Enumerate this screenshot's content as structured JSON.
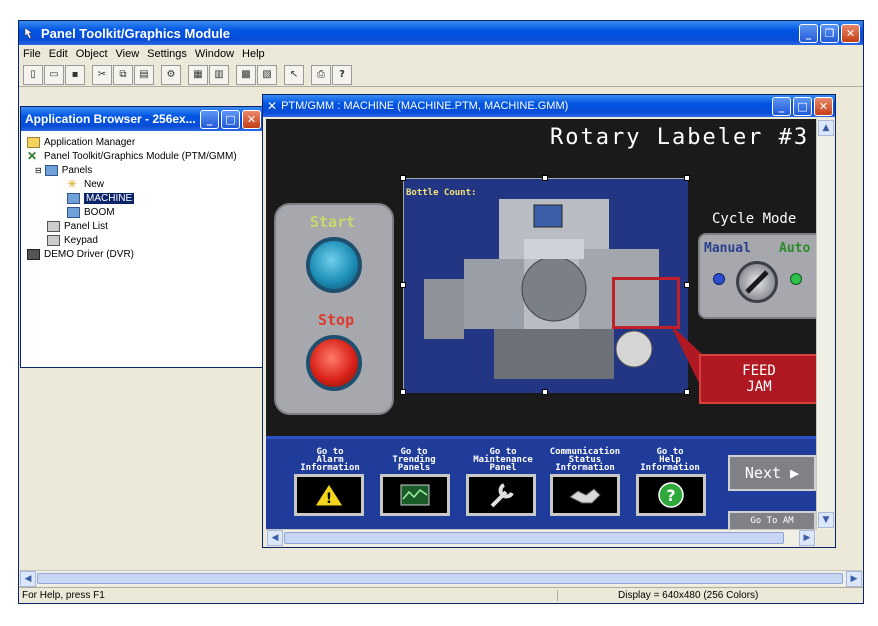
{
  "main_window": {
    "title": "Panel Toolkit/Graphics Module"
  },
  "menu": [
    "File",
    "Edit",
    "Object",
    "View",
    "Settings",
    "Window",
    "Help"
  ],
  "app_browser": {
    "title": "Application Browser - 256ex...",
    "tree": {
      "app_manager": "Application Manager",
      "ptm": "Panel Toolkit/Graphics Module (PTM/GMM)",
      "panels": "Panels",
      "new": "New",
      "machine": "MACHINE",
      "boom": "BOOM",
      "panel_list": "Panel List",
      "keypad": "Keypad",
      "demo_driver": "DEMO Driver (DVR)"
    }
  },
  "ptm_window": {
    "title": "PTM/GMM : MACHINE (MACHINE.PTM, MACHINE.GMM)"
  },
  "hmi": {
    "title": "Rotary Labeler #3",
    "start_label": "Start",
    "stop_label": "Stop",
    "bottle_count_label": "Bottle Count:",
    "cycle_mode_label": "Cycle Mode",
    "manual_label": "Manual",
    "auto_label": "Auto",
    "feed_jam_line1": "FEED",
    "feed_jam_line2": "JAM",
    "next_label": "Next ▶",
    "go_to_am_label": "Go To AM",
    "nav": [
      {
        "l1": "Go to",
        "l2": "Alarm",
        "l3": "Information"
      },
      {
        "l1": "Go to",
        "l2": "Trending",
        "l3": "Panels"
      },
      {
        "l1": "Go to",
        "l2": "Maintenance",
        "l3": "Panel"
      },
      {
        "l1": "Communication",
        "l2": "Status",
        "l3": "Information"
      },
      {
        "l1": "Go to",
        "l2": "Help",
        "l3": "Information"
      }
    ]
  },
  "status_bar": {
    "help_text": "For Help, press F1",
    "display_text": "Display = 640x480 (256 Colors)"
  }
}
